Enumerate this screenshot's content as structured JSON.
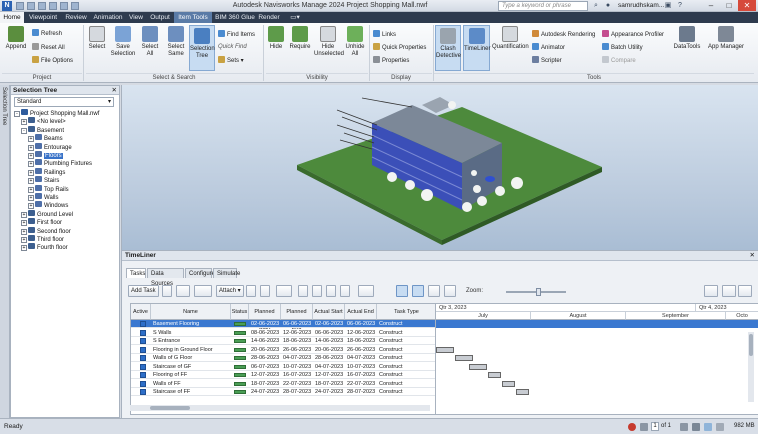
{
  "titlebar": {
    "logo": "N",
    "title": "Autodesk Navisworks Manage 2024    Project Shopping Mall.nwf",
    "search_placeholder": "Type a keyword or phrase",
    "user": "samrudhskam..."
  },
  "tabs": [
    {
      "label": "Home",
      "state": "active"
    },
    {
      "label": "Viewpoint",
      "state": ""
    },
    {
      "label": "Review",
      "state": ""
    },
    {
      "label": "Animation",
      "state": ""
    },
    {
      "label": "View",
      "state": ""
    },
    {
      "label": "Output",
      "state": ""
    },
    {
      "label": "Item Tools",
      "state": "hl"
    },
    {
      "label": "BIM 360 Glue",
      "state": ""
    },
    {
      "label": "Render",
      "state": ""
    }
  ],
  "ribbon": {
    "append": "Append",
    "refresh": "Refresh",
    "reset_all": "Reset All",
    "file_options": "File Options",
    "select": "Select",
    "save_selection": "Save Selection",
    "select_all": "Select All",
    "select_same": "Select Same",
    "selection_tree": "Selection Tree",
    "find_items": "Find Items",
    "quick_find": "Quick Find",
    "sets": "Sets",
    "hide": "Hide",
    "require": "Require",
    "hide_unselected": "Hide Unselected",
    "unhide_all": "Unhide All",
    "links": "Links",
    "quick_properties": "Quick Properties",
    "properties": "Properties",
    "clash_detective": "Clash Detective",
    "timeliner": "TimeLiner",
    "quantification": "Quantification",
    "autodesk_rendering": "Autodesk Rendering",
    "animator": "Animator",
    "scripter": "Scripter",
    "appearance_profiler": "Appearance Profiler",
    "batch_utility": "Batch Utility",
    "compare": "Compare",
    "datatools": "DataTools",
    "app_manager": "App Manager",
    "groups": {
      "project": "Project",
      "select_search": "Select & Search",
      "visibility": "Visibility",
      "display": "Display",
      "tools": "Tools"
    }
  },
  "side_strip": {
    "label": "Selection Tree"
  },
  "selection_tree": {
    "title": "Selection Tree",
    "dropdown": "Standard",
    "nodes": [
      {
        "label": "Project Shopping Mall.nwf",
        "level": 0,
        "exp": "-",
        "sel": false
      },
      {
        "label": "<No level>",
        "level": 1,
        "exp": "+",
        "sel": false
      },
      {
        "label": "Basement",
        "level": 1,
        "exp": "-",
        "sel": false
      },
      {
        "label": "Beams",
        "level": 2,
        "exp": "+",
        "sel": false
      },
      {
        "label": "Entourage",
        "level": 2,
        "exp": "+",
        "sel": false
      },
      {
        "label": "Floors",
        "level": 2,
        "exp": "+",
        "sel": true
      },
      {
        "label": "Plumbing Fixtures",
        "level": 2,
        "exp": "+",
        "sel": false
      },
      {
        "label": "Railings",
        "level": 2,
        "exp": "+",
        "sel": false
      },
      {
        "label": "Stairs",
        "level": 2,
        "exp": "+",
        "sel": false
      },
      {
        "label": "Top Rails",
        "level": 2,
        "exp": "+",
        "sel": false
      },
      {
        "label": "Walls",
        "level": 2,
        "exp": "+",
        "sel": false
      },
      {
        "label": "Windows",
        "level": 2,
        "exp": "+",
        "sel": false
      },
      {
        "label": "Ground Level",
        "level": 1,
        "exp": "+",
        "sel": false
      },
      {
        "label": "First floor",
        "level": 1,
        "exp": "+",
        "sel": false
      },
      {
        "label": "Second floor",
        "level": 1,
        "exp": "+",
        "sel": false
      },
      {
        "label": "Third floor",
        "level": 1,
        "exp": "+",
        "sel": false
      },
      {
        "label": "Fourth floor",
        "level": 1,
        "exp": "+",
        "sel": false
      }
    ]
  },
  "timeliner": {
    "title": "TimeLiner",
    "tabs": [
      "Tasks",
      "Data Sources",
      "Configure",
      "Simulate"
    ],
    "add_task": "Add Task",
    "attach": "Attach",
    "zoom_label": "Zoom:",
    "zoom": 0.55,
    "columns": [
      "Active",
      "Name",
      "Status",
      "Planned Start",
      "Planned End",
      "Actual Start",
      "Actual End",
      "Task Type"
    ],
    "quarters": [
      "Qtr 3, 2023",
      "Qtr 4, 2023"
    ],
    "months": [
      "July",
      "August",
      "September",
      "Octo"
    ],
    "tasks": [
      {
        "name": "Basement Flooring",
        "ps": "02-06-2023",
        "pe": "06-06-2023",
        "as": "02-06-2023",
        "ae": "06-06-2023",
        "type": "Construct",
        "sel": true,
        "bar": null
      },
      {
        "name": "S Walls",
        "ps": "08-06-2023",
        "pe": "12-06-2023",
        "as": "06-06-2023",
        "ae": "12-06-2023",
        "type": "Construct",
        "sel": false,
        "bar": null
      },
      {
        "name": "S Entrance",
        "ps": "14-06-2023",
        "pe": "18-06-2023",
        "as": "14-06-2023",
        "ae": "18-06-2023",
        "type": "Construct",
        "sel": false,
        "bar": null
      },
      {
        "name": "Flooring in Ground Floor",
        "ps": "20-06-2023",
        "pe": "26-06-2023",
        "as": "20-06-2023",
        "ae": "26-06-2023",
        "type": "Construct",
        "sel": false,
        "bar": [
          0,
          6
        ]
      },
      {
        "name": "Walls of G Floor",
        "ps": "28-06-2023",
        "pe": "04-07-2023",
        "as": "28-06-2023",
        "ae": "04-07-2023",
        "type": "Construct",
        "sel": false,
        "bar": [
          8,
          14
        ]
      },
      {
        "name": "Staircase of GF",
        "ps": "06-07-2023",
        "pe": "10-07-2023",
        "as": "04-07-2023",
        "ae": "10-07-2023",
        "type": "Construct",
        "sel": false,
        "bar": [
          14,
          20
        ]
      },
      {
        "name": "Flooring of FF",
        "ps": "12-07-2023",
        "pe": "16-07-2023",
        "as": "12-07-2023",
        "ae": "16-07-2023",
        "type": "Construct",
        "sel": false,
        "bar": [
          22,
          26
        ]
      },
      {
        "name": "Walls of FF",
        "ps": "18-07-2023",
        "pe": "22-07-2023",
        "as": "18-07-2023",
        "ae": "22-07-2023",
        "type": "Construct",
        "sel": false,
        "bar": [
          28,
          32
        ]
      },
      {
        "name": "Staircase of FF",
        "ps": "24-07-2023",
        "pe": "28-07-2023",
        "as": "24-07-2023",
        "ae": "28-07-2023",
        "type": "Construct",
        "sel": false,
        "bar": [
          34,
          38
        ]
      }
    ]
  },
  "status": {
    "text": "Ready",
    "page": "1",
    "of": "of 1",
    "memory": "982 MB"
  },
  "colors": {
    "accent": "#3a78d0",
    "tabbar": "#2e3b4e",
    "ground": "#4d8a3c"
  }
}
